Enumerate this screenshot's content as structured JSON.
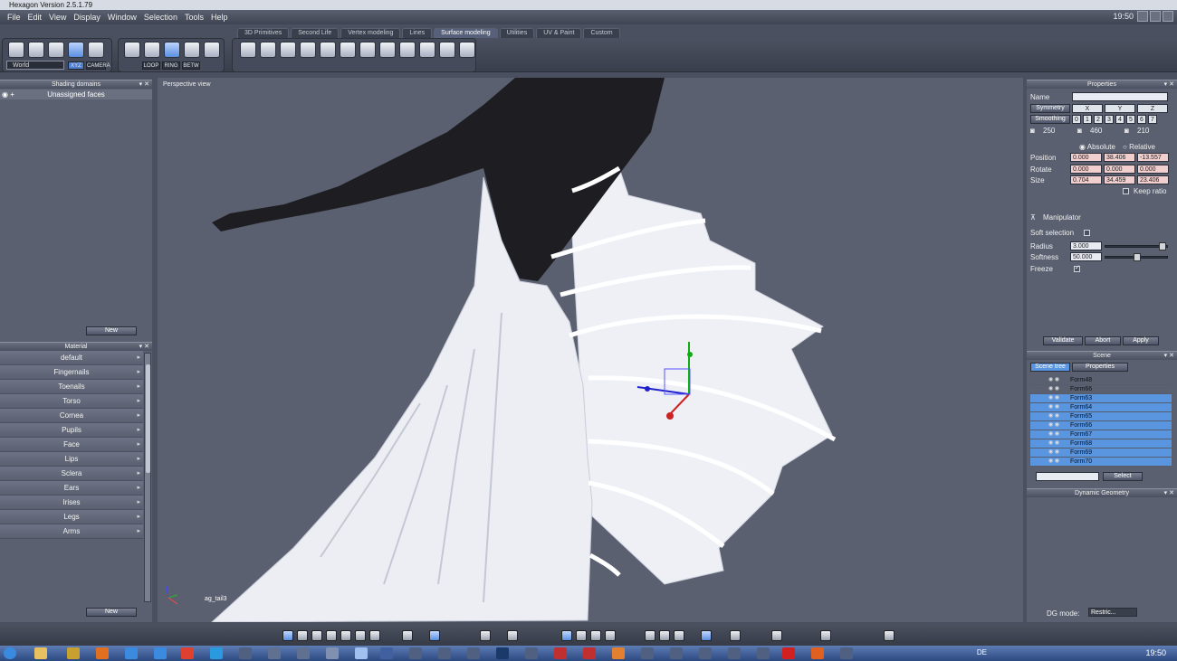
{
  "titlebar": {
    "title": "Hexagon Version 2.5.1.79"
  },
  "menu": {
    "items": [
      "File",
      "Edit",
      "View",
      "Display",
      "Window",
      "Selection",
      "Tools",
      "Help"
    ],
    "clock": "19:50"
  },
  "tabs": [
    "3D Primitives",
    "Second Life",
    "Vertex modeling",
    "Lines",
    "Surface modeling",
    "Utilities",
    "UV & Paint",
    "Custom"
  ],
  "active_tab": "Surface modeling",
  "toolbar": {
    "coord_space": "World",
    "xyz": "XYZ",
    "camera": "CAMERA",
    "loop": "LOOP",
    "ring": "RING",
    "betw": "BETW"
  },
  "shading": {
    "title": "Shading domains",
    "item": "Unassigned faces",
    "new": "New"
  },
  "material": {
    "title": "Material",
    "items": [
      "default",
      "Fingernails",
      "Toenails",
      "Torso",
      "Cornea",
      "Pupils",
      "Face",
      "Lips",
      "Sclera",
      "Ears",
      "Irises",
      "Legs",
      "Arms"
    ],
    "new": "New"
  },
  "viewport": {
    "label": "Perspective view",
    "object_label": "ag_tail3"
  },
  "properties": {
    "title": "Properties",
    "name_label": "Name",
    "name_value": "",
    "symmetry": "Symmetry",
    "axes": [
      "X",
      "Y",
      "Z"
    ],
    "smoothing": "Smoothing",
    "smoothing_levels": [
      "0",
      "1",
      "2",
      "3",
      "4",
      "5",
      "6",
      "7"
    ],
    "counts": [
      "250",
      "460",
      "210"
    ],
    "absolute": "Absolute",
    "relative": "Relative",
    "position_label": "Position",
    "position": [
      "0.000",
      "38.406",
      "-13.557"
    ],
    "rotate_label": "Rotate",
    "rotate": [
      "0.000",
      "0.000",
      "0.000"
    ],
    "size_label": "Size",
    "size": [
      "0.704",
      "34.459",
      "23.406"
    ],
    "keep_ratio": "Keep ratio",
    "manipulator": "Manipulator",
    "soft_selection": "Soft selection",
    "radius_label": "Radius",
    "radius": "3.000",
    "radius_level": 0.95,
    "softness_label": "Softness",
    "softness": "50.000",
    "softness_level": 0.5,
    "freeze": "Freeze",
    "validate": "Validate",
    "abort": "Abort",
    "apply": "Apply"
  },
  "scene": {
    "title": "Scene",
    "tab_tree": "Scene tree",
    "tab_props": "Properties",
    "rows": [
      {
        "name": "Form48",
        "sel": false
      },
      {
        "name": "Form66",
        "sel": false
      },
      {
        "name": "Form63",
        "sel": true
      },
      {
        "name": "Form64",
        "sel": true
      },
      {
        "name": "Form65",
        "sel": true
      },
      {
        "name": "Form66",
        "sel": true
      },
      {
        "name": "Form67",
        "sel": true
      },
      {
        "name": "Form68",
        "sel": true
      },
      {
        "name": "Form69",
        "sel": true
      },
      {
        "name": "Form70",
        "sel": true
      }
    ],
    "select": "Select"
  },
  "dynamic_geometry": {
    "title": "Dynamic Geometry",
    "dg_mode_label": "DG mode:",
    "dg_mode": "Restric..."
  },
  "taskbar": {
    "lang": "DE",
    "clock": "19:50"
  },
  "colors": {
    "selection": "#5a95e0",
    "panel": "#5a6070",
    "viewport": "#5b6070"
  }
}
